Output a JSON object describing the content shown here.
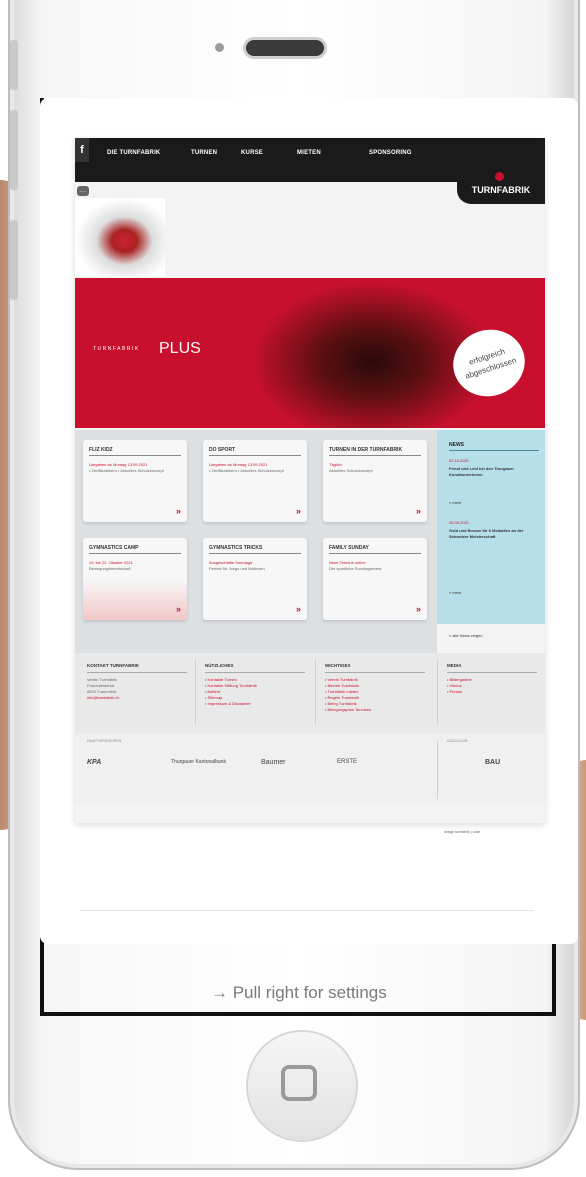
{
  "nav": {
    "items": [
      "DIE TURNFABRIK",
      "TURNEN",
      "KURSE",
      "MIETEN",
      "SPONSORING"
    ],
    "fb": "f",
    "brand": "TURNFABRIK"
  },
  "hero": {
    "tagline": "TURNFABRIK",
    "plus": "PLUS",
    "seal_line1": "erfolgreich",
    "seal_line2": "abgeschlossen"
  },
  "cards": [
    {
      "title": "FLIZ KIDZ",
      "red": "Umgaben ab Montag 13.09.2021",
      "gray": "• Zertifikatsform\n• Aktuelles Schutzkonzept"
    },
    {
      "title": "DO SPORT",
      "red": "Umgaben ab Montag 13.09.2021",
      "gray": "• Zertifikatsform\n• Aktuelles Schutzkonzept"
    },
    {
      "title": "TURNEN IN DER TURNFABRIK",
      "red": "Täglich",
      "gray": "Aktuelles Schutzkonzept"
    },
    {
      "title": "GYMNASTICS CAMP",
      "red": "19. bis 22. Oktober 2021",
      "gray": "Bewegungsbereitschaft"
    },
    {
      "title": "GYMNASTICS TRICKS",
      "red": "Ausgeschlafte Sonntage",
      "gray": "Perfekt für Jungs und Mädchen"
    },
    {
      "title": "FAMILY SUNDAY",
      "red": "Neue Termine online",
      "gray": "Der sportliche Sonntagsevent"
    }
  ],
  "news": {
    "title": "NEWS",
    "item1_date": "02.10.2021",
    "item1_text": "Freud und Leid bei den Thurgauer Kunstturnerinnen",
    "item2_date": "28.09.2021",
    "item2_text": "Gold und Bronze für 6 Medaillen an der Schweizer Meisterschaft",
    "more": "» mehr",
    "all": "» alle News zeigen"
  },
  "footer": {
    "col1_title": "KONTAKT TURNFABRIK",
    "col1_items": [
      "Verein Turnfabrik",
      "Frauenfelderstr.",
      "8500 Frauenfeld",
      "info@turnfabrik.ch"
    ],
    "col2_title": "NÜTZLICHES",
    "col2_items": [
      "• Kontakte Turnen",
      "• Kontakte Stiftung Turnfabrik",
      "• Anfahrt",
      "• Sitemap",
      "• Impressum & Disclaimer"
    ],
    "col3_title": "WICHTIGES",
    "col3_items": [
      "• Verein Turnfabrik",
      "• Betrieb Turnfabrik",
      "• Turnfabrik mieten",
      "• Regeln Turnfabrik",
      "• Beleg Turnfabrik",
      "• Belegungsplan Tennisen"
    ],
    "col4_title": "MEDIA",
    "col4_items": [
      "• Bildergalerie",
      "• Videos",
      "• Presse"
    ]
  },
  "sponsors": {
    "label_main": "HAUPTSPONSOREN",
    "label_side": "GOLD-CLUB",
    "logos": [
      "KPA",
      "Thurgauer Kantonalbank",
      "Baumer",
      "ERSTE"
    ],
    "side_logo": "BAU"
  },
  "credits": "design turnfabrik | code",
  "pull_text": "→ Pull right for settings"
}
